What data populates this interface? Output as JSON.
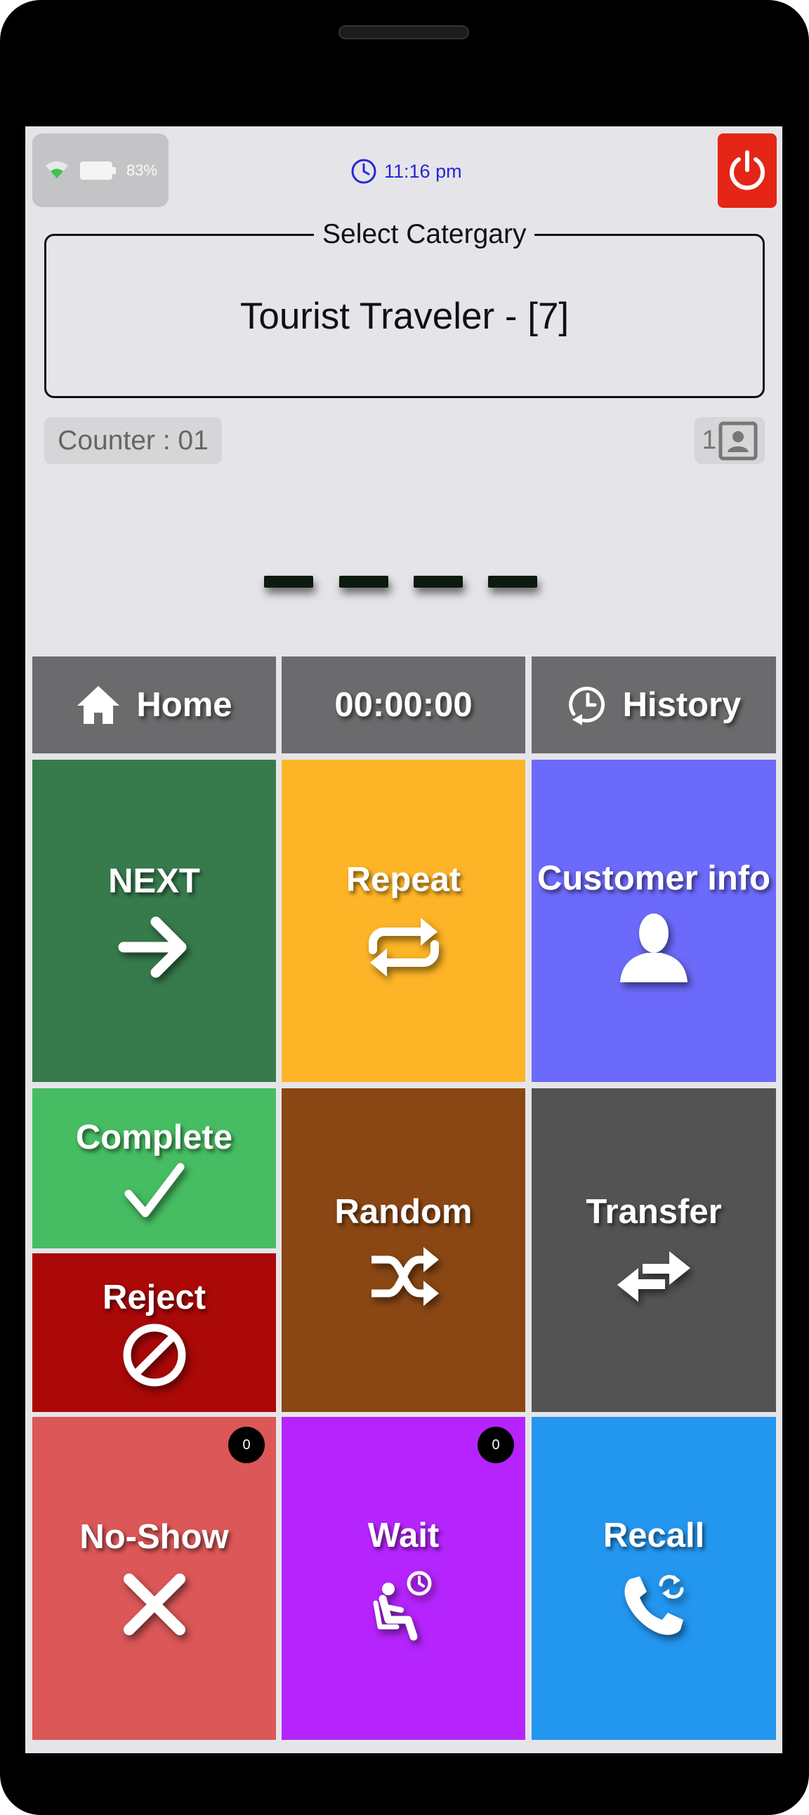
{
  "status_bar": {
    "battery_percent": "83%",
    "time": "11:16 pm"
  },
  "category": {
    "legend": "Select Catergary",
    "value": "Tourist Traveler - [7]"
  },
  "counter": {
    "label": "Counter : 01"
  },
  "queue": {
    "count": "1"
  },
  "ticket_display": "— — — —",
  "nav": {
    "home_label": "Home",
    "timer": "00:00:00",
    "history_label": "History"
  },
  "actions": {
    "next": "NEXT",
    "repeat": "Repeat",
    "customer_info": "Customer info",
    "complete": "Complete",
    "reject": "Reject",
    "random": "Random",
    "transfer": "Transfer",
    "no_show": "No-Show",
    "no_show_count": "0",
    "wait": "Wait",
    "wait_count": "0",
    "recall": "Recall"
  },
  "colors": {
    "next": "#377b4d",
    "repeat": "#fdb527",
    "customer_info": "#6c6afa",
    "complete": "#46bd62",
    "reject": "#ab0808",
    "random": "#8a4714",
    "transfer": "#535353",
    "no_show": "#db5758",
    "wait": "#b524fc",
    "recall": "#2396f0",
    "nav": "#6b6a6c",
    "power": "#e52516"
  },
  "icons": [
    "wifi-icon",
    "battery-icon",
    "clock-icon",
    "power-icon",
    "contact-card-icon",
    "home-icon",
    "history-icon",
    "arrow-right-icon",
    "repeat-icon",
    "person-icon",
    "checkmark-icon",
    "prohibited-icon",
    "shuffle-icon",
    "transfer-arrows-icon",
    "close-x-icon",
    "waiting-seat-icon",
    "phone-recall-icon"
  ]
}
